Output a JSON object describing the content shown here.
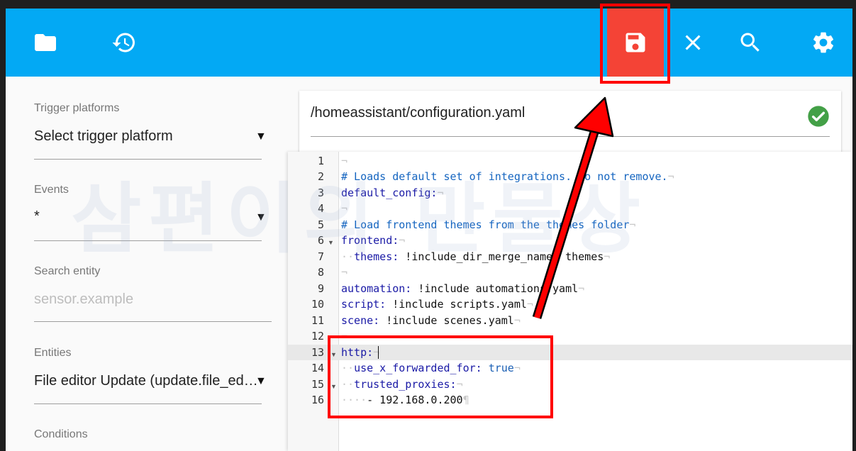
{
  "toolbar": {
    "buttons": [
      {
        "icon": "folder-icon"
      },
      {
        "icon": "history-icon"
      },
      {
        "icon": "save-icon"
      },
      {
        "icon": "close-icon"
      },
      {
        "icon": "search-icon"
      },
      {
        "icon": "gear-icon"
      }
    ],
    "background": "#03a9f4",
    "save_highlight": "#f44336"
  },
  "left_panel": {
    "trigger_platforms": {
      "label": "Trigger platforms",
      "value": "Select trigger platform"
    },
    "events": {
      "label": "Events",
      "value": "*"
    },
    "search_entity": {
      "label": "Search entity",
      "placeholder": "sensor.example"
    },
    "entities": {
      "label": "Entities",
      "value": "File editor Update (update.file_ed…"
    },
    "conditions": {
      "label": "Conditions"
    }
  },
  "file": {
    "path": "/homeassistant/configuration.yaml",
    "status_icon": "check-circle-icon",
    "status_color": "#43a047"
  },
  "editor": {
    "line_numbers": [
      "1",
      "2",
      "3",
      "4",
      "5",
      "6",
      "7",
      "8",
      "9",
      "10",
      "11",
      "12",
      "13",
      "14",
      "15",
      "16"
    ],
    "lines": {
      "l2": "# Loads default set of integrations. Do not remove.",
      "l3": "default_config:",
      "l5": "# Load frontend themes from the themes folder",
      "l6": "frontend:",
      "l7_key": "themes:",
      "l7_val": " !include_dir_merge_named themes",
      "l9_key": "automation:",
      "l9_val": " !include automations.yaml",
      "l10_key": "script:",
      "l10_val": " !include scripts.yaml",
      "l11_key": "scene:",
      "l11_val": " !include scenes.yaml",
      "l13": "http:",
      "l14_key": "use_x_forwarded_for:",
      "l14_val": " true",
      "l15": "trusted_proxies:",
      "l16": "- 192.168.0.200"
    }
  },
  "watermark": "삼편이의 만물상",
  "annotation_color": "#ff0000"
}
